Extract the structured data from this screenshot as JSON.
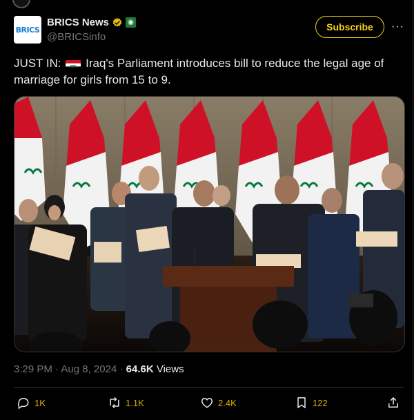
{
  "author": {
    "display_name": "BRICS News",
    "handle": "@BRICSinfo",
    "avatar_text": "BRICS"
  },
  "subscribe_label": "Subscribe",
  "more_label": "···",
  "tweet": {
    "prefix": "JUST IN:",
    "body": "Iraq's Parliament introduces bill to reduce the legal age of marriage for girls from 15 to 9."
  },
  "meta": {
    "time": "3:29 PM",
    "separator": "·",
    "date": "Aug 8, 2024",
    "views_count": "64.6K",
    "views_label": "Views"
  },
  "actions": {
    "replies": "1K",
    "reposts": "1.1K",
    "likes": "2.4K",
    "bookmarks": "122"
  },
  "colors": {
    "background": "#000000",
    "accent": "#d6b300",
    "subscribe": "#f7d31a",
    "display_name": "#e7e9ea",
    "muted": "#71767b",
    "iraq_red": "#ce1126",
    "iraq_green": "#007a3d"
  }
}
